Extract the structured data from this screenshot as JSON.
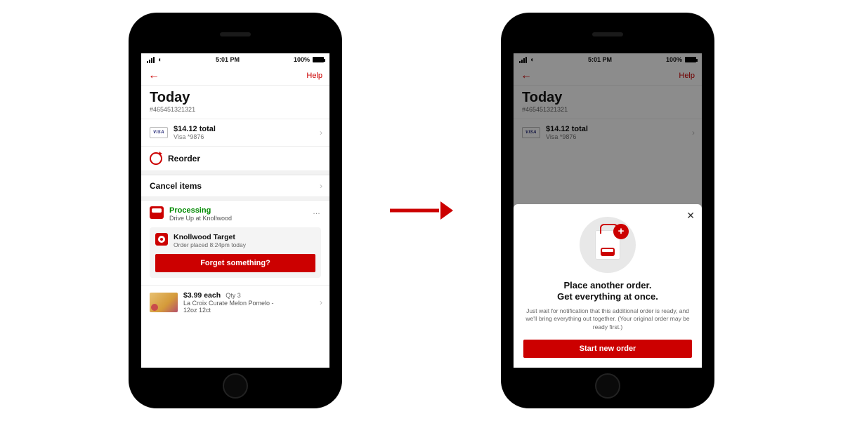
{
  "status": {
    "time": "5:01 PM",
    "battery": "100%"
  },
  "nav": {
    "help": "Help"
  },
  "header": {
    "title": "Today",
    "order_id": "#465451321321"
  },
  "payment": {
    "brand": "VISA",
    "total": "$14.12 total",
    "card": "Visa *9876"
  },
  "reorder": {
    "label": "Reorder"
  },
  "cancel": {
    "label": "Cancel items"
  },
  "processing": {
    "status": "Processing",
    "sub": "Drive Up at Knollwood",
    "store": "Knollwood Target",
    "placed": "Order placed 8:24pm today",
    "forget_btn": "Forget something?"
  },
  "item": {
    "price": "$3.99 each",
    "qty": "Qty 3",
    "name": "La Croix Curate Melon Pomelo - 12oz 12ct"
  },
  "sheet": {
    "title_l1": "Place another order.",
    "title_l2": "Get everything at once.",
    "body": "Just wait for notification that this additional order is ready, and we'll bring everything out together. (Your original order may be ready first.)",
    "cta": "Start new order"
  }
}
